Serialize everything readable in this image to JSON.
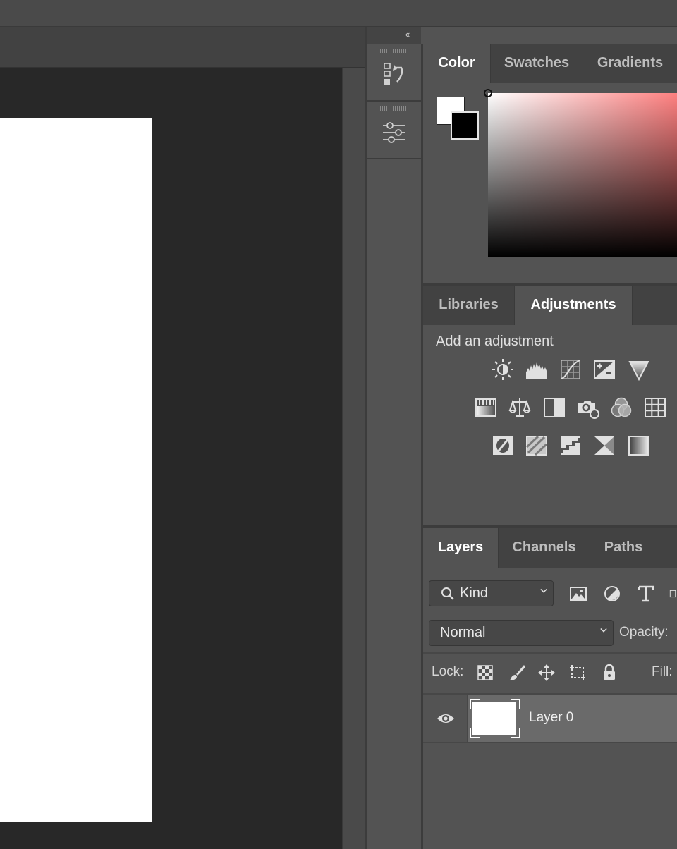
{
  "color_panel": {
    "tabs": [
      {
        "label": "Color",
        "active": true
      },
      {
        "label": "Swatches",
        "active": false
      },
      {
        "label": "Gradients",
        "active": false
      }
    ],
    "foreground_color": "#ffffff",
    "background_color": "#000000",
    "field_hue": "#ff8080"
  },
  "adjustments_panel": {
    "tabs": [
      {
        "label": "Libraries",
        "active": false
      },
      {
        "label": "Adjustments",
        "active": true
      }
    ],
    "heading": "Add an adjustment",
    "icons_row1": [
      "brightness-contrast-icon",
      "levels-icon",
      "curves-icon",
      "exposure-icon",
      "vibrance-icon"
    ],
    "icons_row2": [
      "hue-saturation-icon",
      "color-balance-icon",
      "black-white-icon",
      "photo-filter-icon",
      "channel-mixer-icon",
      "color-lookup-icon"
    ],
    "icons_row3": [
      "invert-icon",
      "posterize-icon",
      "threshold-icon",
      "selective-color-icon",
      "gradient-map-icon"
    ]
  },
  "layers_panel": {
    "tabs": [
      {
        "label": "Layers",
        "active": true
      },
      {
        "label": "Channels",
        "active": false
      },
      {
        "label": "Paths",
        "active": false
      }
    ],
    "filter_label": "Kind",
    "blend_mode": "Normal",
    "opacity_label": "Opacity:",
    "lock_label": "Lock:",
    "fill_label": "Fill:",
    "layers": [
      {
        "name": "Layer 0",
        "visible": true,
        "selected": true
      }
    ]
  },
  "dock": {
    "collapse_glyph": "‹‹",
    "items": [
      "history-icon",
      "properties-icon"
    ]
  },
  "colors": {
    "ui_bg": "#535353",
    "canvas_bg": "#282828",
    "artboard": "#ffffff",
    "tab_inactive": "#424242"
  }
}
